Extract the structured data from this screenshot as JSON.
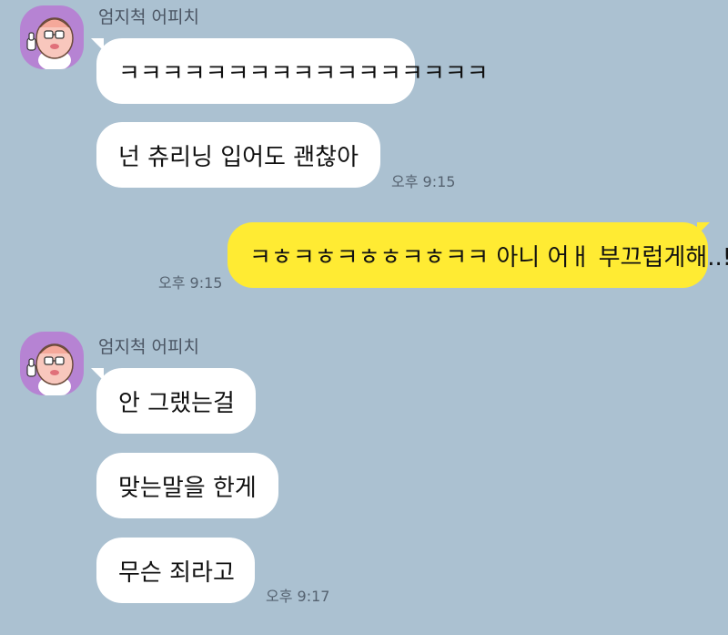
{
  "messages": [
    {
      "sender": "엄지척 어피치",
      "avatar_icon": "apeach-avatar-icon",
      "bubbles": [
        "ㅋㅋㅋㅋㅋㅋㅋㅋㅋㅋㅋㅋㅋㅋㅋㅋㅋ",
        "넌 츄리닝 입어도 괜찮아"
      ],
      "time": "오후 9:15"
    },
    {
      "sender": "me",
      "bubbles": [
        "ㅋㅎㅋㅎㅋㅎㅎㅋㅎㅋㅋ 아니 어ㅐ 부끄럽게해..!!"
      ],
      "time": "오후 9:15"
    },
    {
      "sender": "엄지척 어피치",
      "avatar_icon": "apeach-avatar-icon",
      "bubbles": [
        "안 그랬는걸",
        "맞는말을 한게",
        "무슨 죄라고"
      ],
      "time": "오후 9:17"
    }
  ],
  "colors": {
    "background": "#abc1d1",
    "incoming_bubble": "#ffffff",
    "outgoing_bubble": "#ffeb33",
    "avatar_bg": "#b683d3"
  }
}
